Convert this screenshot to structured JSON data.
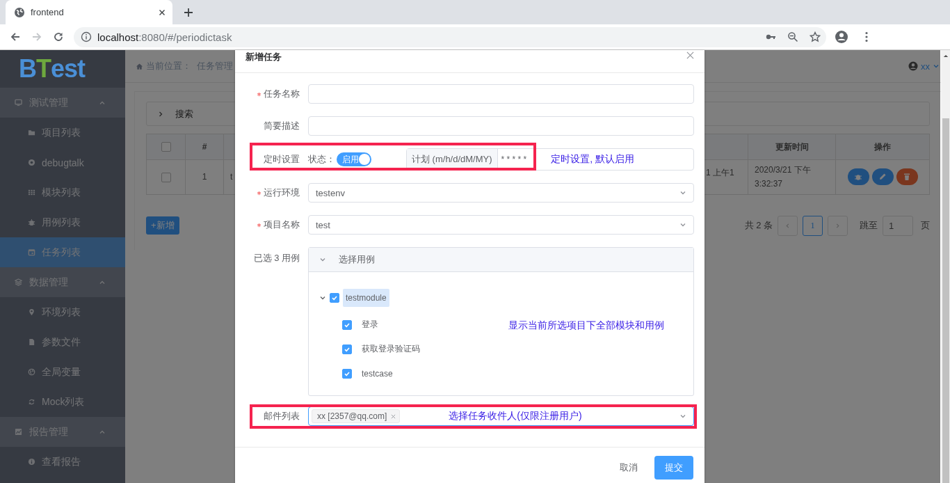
{
  "browser": {
    "tab": {
      "title": "frontend"
    },
    "address": {
      "host": "localhost",
      "path": ":8080/#/periodictask"
    }
  },
  "sidebar": {
    "logo": {
      "lead": "B",
      "accent": "T",
      "rest": "est"
    },
    "groups": [
      {
        "label": "测试管理",
        "expanded": true,
        "items": [
          {
            "label": "项目列表",
            "selected": false
          },
          {
            "label": "debugtalk",
            "selected": false
          },
          {
            "label": "模块列表",
            "selected": false
          },
          {
            "label": "用例列表",
            "selected": false
          },
          {
            "label": "任务列表",
            "selected": true
          }
        ]
      },
      {
        "label": "数据管理",
        "expanded": true,
        "items": [
          {
            "label": "环境列表",
            "selected": false
          },
          {
            "label": "参数文件",
            "selected": false
          },
          {
            "label": "全局变量",
            "selected": false
          },
          {
            "label": "Mock列表",
            "selected": false
          }
        ]
      },
      {
        "label": "报告管理",
        "expanded": true,
        "items": [
          {
            "label": "查看报告",
            "selected": false
          }
        ]
      }
    ]
  },
  "header": {
    "breadcrumb_label": "当前位置：",
    "breadcrumb": "任务管理",
    "user": "xx"
  },
  "search_panel": {
    "label": "搜索",
    "expanded": false
  },
  "table": {
    "select_all_checked": false,
    "number_heading": "#",
    "right_headings": [
      "更新时间",
      "操作"
    ],
    "rows": [
      {
        "checked": false,
        "number": "1",
        "column_3": "t",
        "column_4": "1 上午1",
        "updated": "2020/3/21 下午3:32:37"
      }
    ]
  },
  "add_button": "+新增",
  "pagination": {
    "total": "共 2 条",
    "pages": [
      {
        "label": "1",
        "selected": true
      }
    ],
    "jump_label": "跳至",
    "jump_value": "1",
    "page_unit": "页"
  },
  "dialog": {
    "title": "新增任务",
    "fields": [
      {
        "kind": "text",
        "label": "任务名称",
        "required": true
      },
      {
        "kind": "text",
        "label": "简要描述",
        "required": false
      },
      {
        "kind": "schedule",
        "label": "定时设置",
        "required": false,
        "highlighted": true,
        "status_label": "状态：",
        "switch": {
          "on": true,
          "label": "启用"
        },
        "prepend": "计划 (m/h/d/dM/MY)",
        "value": "* * * * *",
        "note": "定时设置, 默认启用"
      },
      {
        "kind": "select",
        "label": "运行环境",
        "required": true,
        "value": "testenv"
      },
      {
        "kind": "select",
        "label": "项目名称",
        "required": true,
        "value": "test"
      },
      {
        "kind": "tree",
        "label": "已选 3 用例",
        "required": false,
        "panel_title": "选择用例",
        "expanded": true,
        "note": "显示当前所选项目下全部模块和用例",
        "tree": [
          {
            "label": "testmodule",
            "checked": true,
            "selected": true,
            "expanded": true,
            "children": [
              {
                "label": "登录",
                "checked": true,
                "selected": false
              },
              {
                "label": "获取登录验证码",
                "checked": true,
                "selected": false
              },
              {
                "label": "testcase",
                "checked": true,
                "selected": false
              }
            ]
          }
        ]
      },
      {
        "kind": "tags",
        "label": "邮件列表",
        "required": false,
        "highlighted": true,
        "focused": true,
        "tags": [
          "xx [2357@qq.com]"
        ],
        "note": "选择任务收件人(仅限注册用户)"
      }
    ],
    "cancel": "取消",
    "submit": "提交"
  }
}
